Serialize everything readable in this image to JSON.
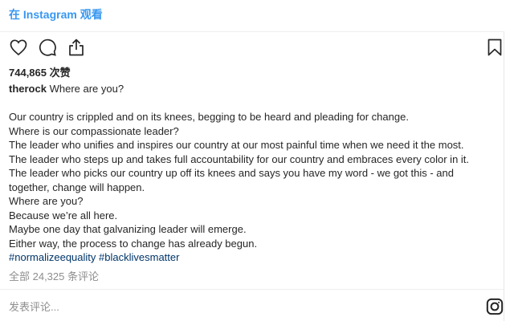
{
  "header": {
    "view_on_instagram": "在 Instagram 观看"
  },
  "post": {
    "likes": "744,865 次赞",
    "username": "therock",
    "headline": "Where are you?",
    "body_lines": [
      "Our country is crippled and on its knees, begging to be heard and pleading for change.",
      "Where is our compassionate leader?",
      "The leader who unifies and inspires our country at our most painful time when we need it the most.",
      "The leader who steps up and takes full accountability for our country and embraces every color in it.",
      "The leader who picks our country up off its knees and says you have my word - we got this - and",
      "together, change will happen.",
      "Where are you?",
      "Because we’re all here.",
      "Maybe one day that galvanizing leader will emerge.",
      "Either way, the process to change has already begun."
    ],
    "hashtags": [
      "#normalizeequality",
      "#blacklivesmatter"
    ],
    "comments_link": "全部 24,325 条评论"
  },
  "comment_box": {
    "placeholder": "发表评论..."
  },
  "icons": {
    "like": "heart-icon",
    "comment": "comment-bubble-icon",
    "share": "share-icon",
    "save": "bookmark-icon",
    "brand": "instagram-glyph-icon"
  },
  "colors": {
    "link_blue": "#3897f0",
    "hashtag": "#003569",
    "muted": "#8e8e8e",
    "text": "#262626"
  }
}
